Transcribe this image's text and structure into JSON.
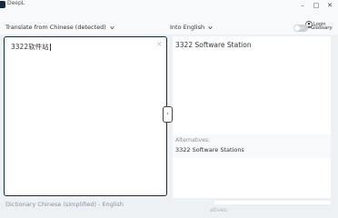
{
  "window": {
    "title": "DeepL",
    "minimize_glyph": "–",
    "maximize_glyph": "□",
    "close_glyph": "✕"
  },
  "header": {
    "source_language": "Translate from Chinese (detected)",
    "target_language": "Into English",
    "login_label": "Login",
    "glossary_toggle_state": "OFF",
    "glossary_label": "Glossary"
  },
  "source": {
    "text": "3322软件站",
    "clear_glyph": "×"
  },
  "swap_glyph": "›",
  "target": {
    "text": "3322 Software Station",
    "alternatives_label": "Alternatives:",
    "alternatives": [
      "3322 Software Stations"
    ]
  },
  "footer": {
    "dictionary_label": "Dictionary Chinese (simplified) - English",
    "partial_label": "atives:"
  },
  "colors": {
    "accent": "#0f2b46",
    "background": "#eef1f3",
    "toggle_off": "#c9d1d9"
  }
}
